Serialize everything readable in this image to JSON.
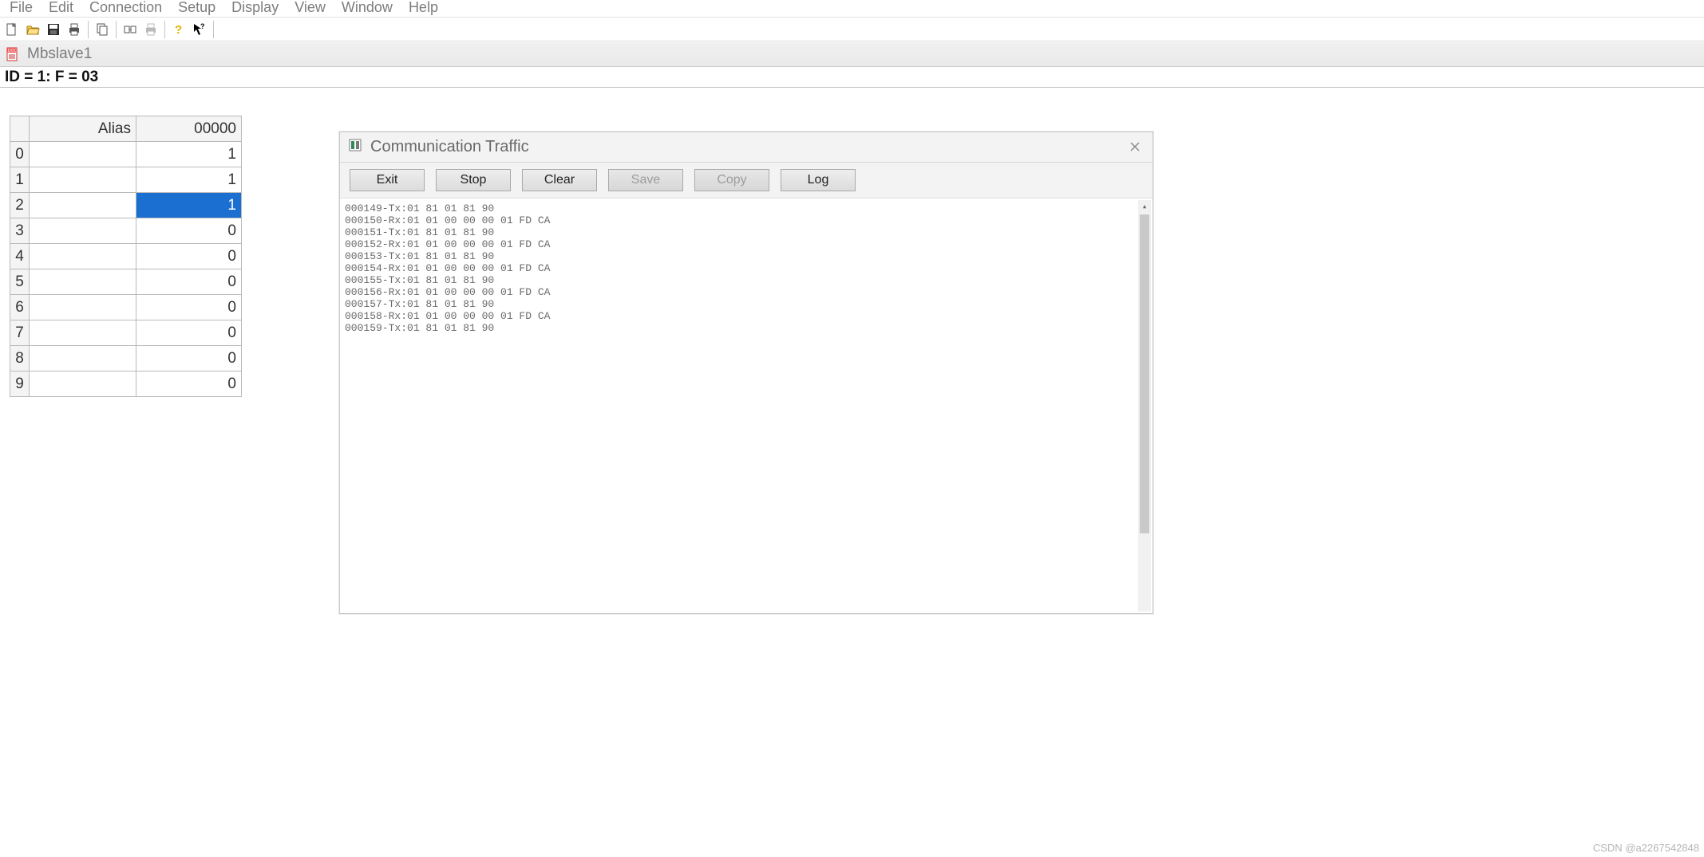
{
  "menu": {
    "items": [
      "File",
      "Edit",
      "Connection",
      "Setup",
      "Display",
      "View",
      "Window",
      "Help"
    ]
  },
  "toolbar": {
    "icons": [
      "new",
      "open",
      "save",
      "print",
      "copy",
      "comm",
      "print2",
      "help",
      "whatsthis"
    ]
  },
  "subwin": {
    "title": "Mbslave1"
  },
  "status": "ID = 1: F = 03",
  "table": {
    "headers": {
      "corner": "",
      "alias": "Alias",
      "val": "00000"
    },
    "rows": [
      {
        "idx": "0",
        "alias": "",
        "val": "1",
        "selected": false
      },
      {
        "idx": "1",
        "alias": "",
        "val": "1",
        "selected": false
      },
      {
        "idx": "2",
        "alias": "",
        "val": "1",
        "selected": true
      },
      {
        "idx": "3",
        "alias": "",
        "val": "0",
        "selected": false
      },
      {
        "idx": "4",
        "alias": "",
        "val": "0",
        "selected": false
      },
      {
        "idx": "5",
        "alias": "",
        "val": "0",
        "selected": false
      },
      {
        "idx": "6",
        "alias": "",
        "val": "0",
        "selected": false
      },
      {
        "idx": "7",
        "alias": "",
        "val": "0",
        "selected": false
      },
      {
        "idx": "8",
        "alias": "",
        "val": "0",
        "selected": false
      },
      {
        "idx": "9",
        "alias": "",
        "val": "0",
        "selected": false
      }
    ]
  },
  "dialog": {
    "title": "Communication Traffic",
    "buttons": {
      "exit": "Exit",
      "stop": "Stop",
      "clear": "Clear",
      "save": "Save",
      "copy": "Copy",
      "log": "Log"
    },
    "disabled": [
      "save",
      "copy"
    ],
    "log_lines": [
      "000149-Tx:01 81 01 81 90",
      "000150-Rx:01 01 00 00 00 01 FD CA",
      "000151-Tx:01 81 01 81 90",
      "000152-Rx:01 01 00 00 00 01 FD CA",
      "000153-Tx:01 81 01 81 90",
      "000154-Rx:01 01 00 00 00 01 FD CA",
      "000155-Tx:01 81 01 81 90",
      "000156-Rx:01 01 00 00 00 01 FD CA",
      "000157-Tx:01 81 01 81 90",
      "000158-Rx:01 01 00 00 00 01 FD CA",
      "000159-Tx:01 81 01 81 90"
    ]
  },
  "watermark": "CSDN @a2267542848"
}
